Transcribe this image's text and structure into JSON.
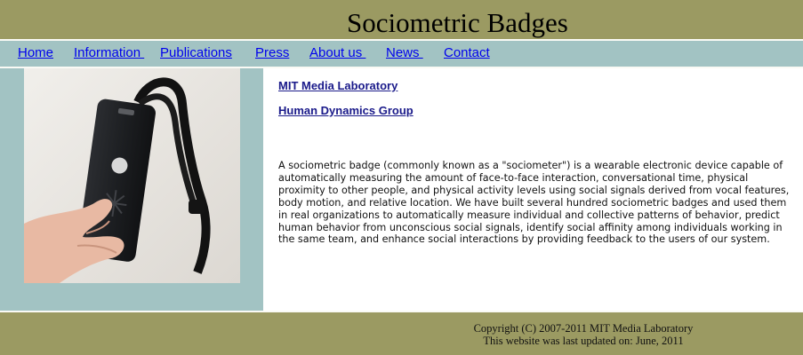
{
  "header": {
    "title": "Sociometric Badges"
  },
  "nav": {
    "items": [
      {
        "label": "Home"
      },
      {
        "label": "Information "
      },
      {
        "label": "Publications"
      },
      {
        "label": "Press"
      },
      {
        "label": "About us "
      },
      {
        "label": "News "
      },
      {
        "label": "Contact"
      }
    ]
  },
  "main": {
    "links": [
      {
        "label": "MIT Media Laboratory"
      },
      {
        "label": "Human Dynamics Group"
      }
    ],
    "description": "A sociometric badge (commonly known as a \"sociometer\") is a wearable electronic device capable of automatically measuring the amount of face-to-face interaction, conversational time, physical proximity to other people, and physical activity levels using social signals derived from vocal features, body motion, and relative location. We have built several hundred sociometric badges and used them in real organizations to automatically measure individual and collective patterns of behavior, predict human behavior from unconscious social signals, identify social affinity among individuals working in the same team, and enhance social interactions by providing feedback to the users of our system."
  },
  "footer": {
    "copyright": "Copyright (C) 2007-2011 MIT Media Laboratory",
    "updated": "This website was last updated on: June, 2011"
  },
  "colors": {
    "header_bg": "#9b9a62",
    "nav_bg": "#a2c3c3",
    "link": "#0000ee",
    "org_link": "#1a1a8a"
  }
}
